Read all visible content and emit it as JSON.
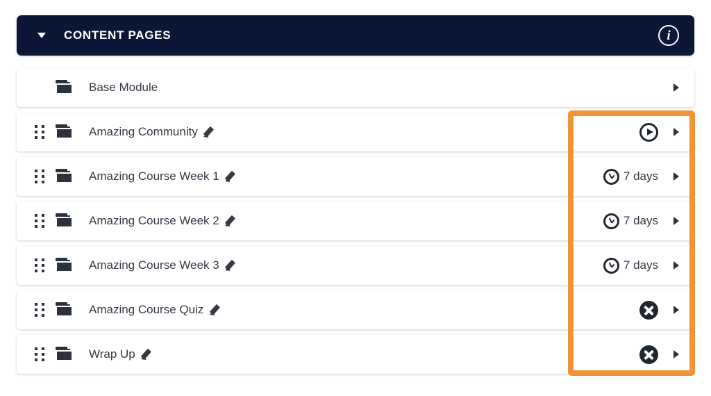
{
  "header": {
    "title": "CONTENT PAGES",
    "caret_icon": "caret-down-icon",
    "info_icon": "info-circle-icon",
    "info_glyph": "i",
    "background_color": "#0C1738",
    "text_color": "#FFFFFF"
  },
  "highlight": {
    "color": "#EE9336",
    "border_width_px": 8
  },
  "rows": [
    {
      "label": "Base Module",
      "has_drag_handle": false,
      "has_edit_pencil": false,
      "folder_icon": "folder-icon",
      "status_type": "none",
      "status_text": "",
      "expand_icon": "chevron-right-icon",
      "highlighted": false
    },
    {
      "label": "Amazing Community",
      "has_drag_handle": true,
      "has_edit_pencil": true,
      "folder_icon": "folder-icon",
      "status_type": "play",
      "status_text": "",
      "expand_icon": "chevron-right-icon",
      "highlighted": true
    },
    {
      "label": "Amazing Course Week 1",
      "has_drag_handle": true,
      "has_edit_pencil": true,
      "folder_icon": "folder-icon",
      "status_type": "clock",
      "status_text": "7 days",
      "expand_icon": "chevron-right-icon",
      "highlighted": true
    },
    {
      "label": "Amazing Course Week 2",
      "has_drag_handle": true,
      "has_edit_pencil": true,
      "folder_icon": "folder-icon",
      "status_type": "clock",
      "status_text": "7 days",
      "expand_icon": "chevron-right-icon",
      "highlighted": true
    },
    {
      "label": "Amazing Course Week 3",
      "has_drag_handle": true,
      "has_edit_pencil": true,
      "folder_icon": "folder-icon",
      "status_type": "clock",
      "status_text": "7 days",
      "expand_icon": "chevron-right-icon",
      "highlighted": true
    },
    {
      "label": "Amazing Course Quiz",
      "has_drag_handle": true,
      "has_edit_pencil": true,
      "folder_icon": "folder-icon",
      "status_type": "x",
      "status_text": "",
      "expand_icon": "chevron-right-icon",
      "highlighted": true
    },
    {
      "label": "Wrap Up",
      "has_drag_handle": true,
      "has_edit_pencil": true,
      "folder_icon": "folder-icon",
      "status_type": "x",
      "status_text": "",
      "expand_icon": "chevron-right-icon",
      "highlighted": true
    }
  ]
}
